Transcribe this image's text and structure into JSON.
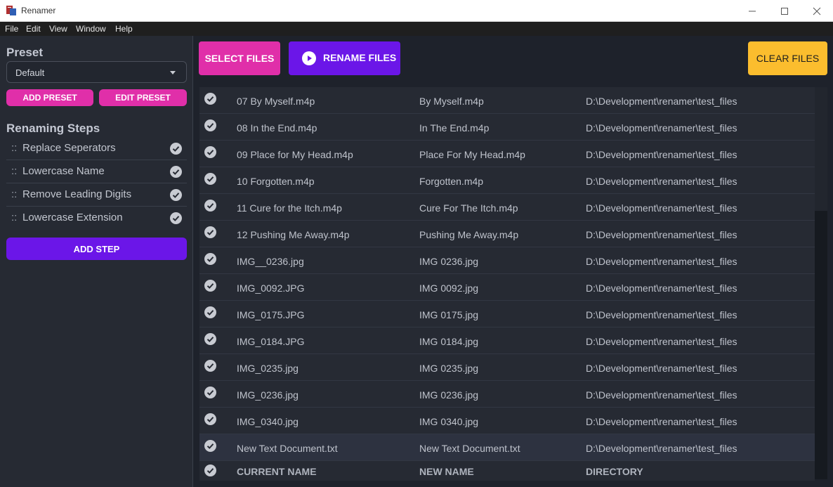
{
  "window": {
    "title": "Renamer"
  },
  "menu": [
    "File",
    "Edit",
    "View",
    "Window",
    "Help"
  ],
  "sidebar": {
    "preset_heading": "Preset",
    "preset_value": "Default",
    "add_preset": "ADD PRESET",
    "edit_preset": "EDIT PRESET",
    "steps_heading": "Renaming Steps",
    "steps": [
      {
        "handle": "::",
        "label": "Replace Seperators"
      },
      {
        "handle": "::",
        "label": "Lowercase Name"
      },
      {
        "handle": "::",
        "label": "Remove Leading Digits"
      },
      {
        "handle": "::",
        "label": "Lowercase Extension"
      }
    ],
    "add_step": "ADD STEP"
  },
  "toolbar": {
    "select_files": "SELECT FILES",
    "rename_files": "RENAME FILES",
    "clear_files": "CLEAR FILES"
  },
  "table": {
    "columns": {
      "current": "CURRENT NAME",
      "new": "NEW NAME",
      "directory": "DIRECTORY"
    },
    "rows": [
      {
        "current": "07 By Myself.m4p",
        "new": "By Myself.m4p",
        "dir": "D:\\Development\\renamer\\test_files"
      },
      {
        "current": "08 In the End.m4p",
        "new": "In The End.m4p",
        "dir": "D:\\Development\\renamer\\test_files"
      },
      {
        "current": "09 Place for My Head.m4p",
        "new": "Place For My Head.m4p",
        "dir": "D:\\Development\\renamer\\test_files"
      },
      {
        "current": "10 Forgotten.m4p",
        "new": "Forgotten.m4p",
        "dir": "D:\\Development\\renamer\\test_files"
      },
      {
        "current": "11 Cure for the Itch.m4p",
        "new": "Cure For The Itch.m4p",
        "dir": "D:\\Development\\renamer\\test_files"
      },
      {
        "current": "12 Pushing Me Away.m4p",
        "new": "Pushing Me Away.m4p",
        "dir": "D:\\Development\\renamer\\test_files"
      },
      {
        "current": "IMG__0236.jpg",
        "new": "IMG 0236.jpg",
        "dir": "D:\\Development\\renamer\\test_files"
      },
      {
        "current": "IMG_0092.JPG",
        "new": "IMG 0092.jpg",
        "dir": "D:\\Development\\renamer\\test_files"
      },
      {
        "current": "IMG_0175.JPG",
        "new": "IMG 0175.jpg",
        "dir": "D:\\Development\\renamer\\test_files"
      },
      {
        "current": "IMG_0184.JPG",
        "new": "IMG 0184.jpg",
        "dir": "D:\\Development\\renamer\\test_files"
      },
      {
        "current": "IMG_0235.jpg",
        "new": "IMG 0235.jpg",
        "dir": "D:\\Development\\renamer\\test_files"
      },
      {
        "current": "IMG_0236.jpg",
        "new": "IMG 0236.jpg",
        "dir": "D:\\Development\\renamer\\test_files"
      },
      {
        "current": "IMG_0340.jpg",
        "new": "IMG 0340.jpg",
        "dir": "D:\\Development\\renamer\\test_files"
      },
      {
        "current": "New Text Document.txt",
        "new": "New Text Document.txt",
        "dir": "D:\\Development\\renamer\\test_files"
      }
    ]
  },
  "colors": {
    "pink": "#e02fa9",
    "purple": "#6b16e8",
    "yellow": "#fbbd2e",
    "background": "#1e222b"
  }
}
